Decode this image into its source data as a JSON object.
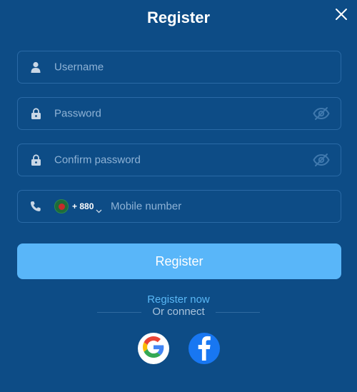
{
  "header": {
    "title": "Register"
  },
  "form": {
    "username": {
      "placeholder": "Username",
      "value": ""
    },
    "password": {
      "placeholder": "Password",
      "value": ""
    },
    "confirm_password": {
      "placeholder": "Confirm password",
      "value": ""
    },
    "mobile": {
      "country_code": "+ 880",
      "placeholder": "Mobile number",
      "value": ""
    }
  },
  "actions": {
    "register_label": "Register",
    "register_now_label": "Register now",
    "or_connect_label": "Or connect"
  },
  "social": [
    "google-icon",
    "facebook-icon"
  ],
  "colors": {
    "background": "#0d4c86",
    "primary_button": "#59b6f9",
    "link": "#5ab7f5",
    "facebook": "#1877f2"
  }
}
